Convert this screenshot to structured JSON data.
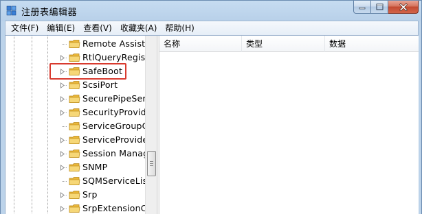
{
  "window": {
    "title": "注册表编辑器",
    "icon": "regedit-icon"
  },
  "menu": [
    {
      "label": "文件(F)"
    },
    {
      "label": "编辑(E)"
    },
    {
      "label": "查看(V)"
    },
    {
      "label": "收藏夹(A)"
    },
    {
      "label": "帮助(H)"
    }
  ],
  "tree": {
    "nodes": [
      {
        "label": "Remote Assista",
        "has_children": false
      },
      {
        "label": "RtlQueryRegist",
        "has_children": true
      },
      {
        "label": "SafeBoot",
        "has_children": true,
        "highlighted": true
      },
      {
        "label": "ScsiPort",
        "has_children": true
      },
      {
        "label": "SecurePipeServ",
        "has_children": true
      },
      {
        "label": "SecurityProvide",
        "has_children": true
      },
      {
        "label": "ServiceGroupO",
        "has_children": false
      },
      {
        "label": "ServiceProvider",
        "has_children": true
      },
      {
        "label": "Session Manag",
        "has_children": true
      },
      {
        "label": "SNMP",
        "has_children": true
      },
      {
        "label": "SQMServiceList",
        "has_children": false
      },
      {
        "label": "Srp",
        "has_children": true
      },
      {
        "label": "SrpExtensionCo",
        "has_children": true
      }
    ]
  },
  "list": {
    "columns": [
      {
        "label": "名称"
      },
      {
        "label": "类型"
      },
      {
        "label": "数据"
      }
    ]
  },
  "colors": {
    "highlight_border": "#d83a2e",
    "folder_yellow": "#f0c34a"
  }
}
